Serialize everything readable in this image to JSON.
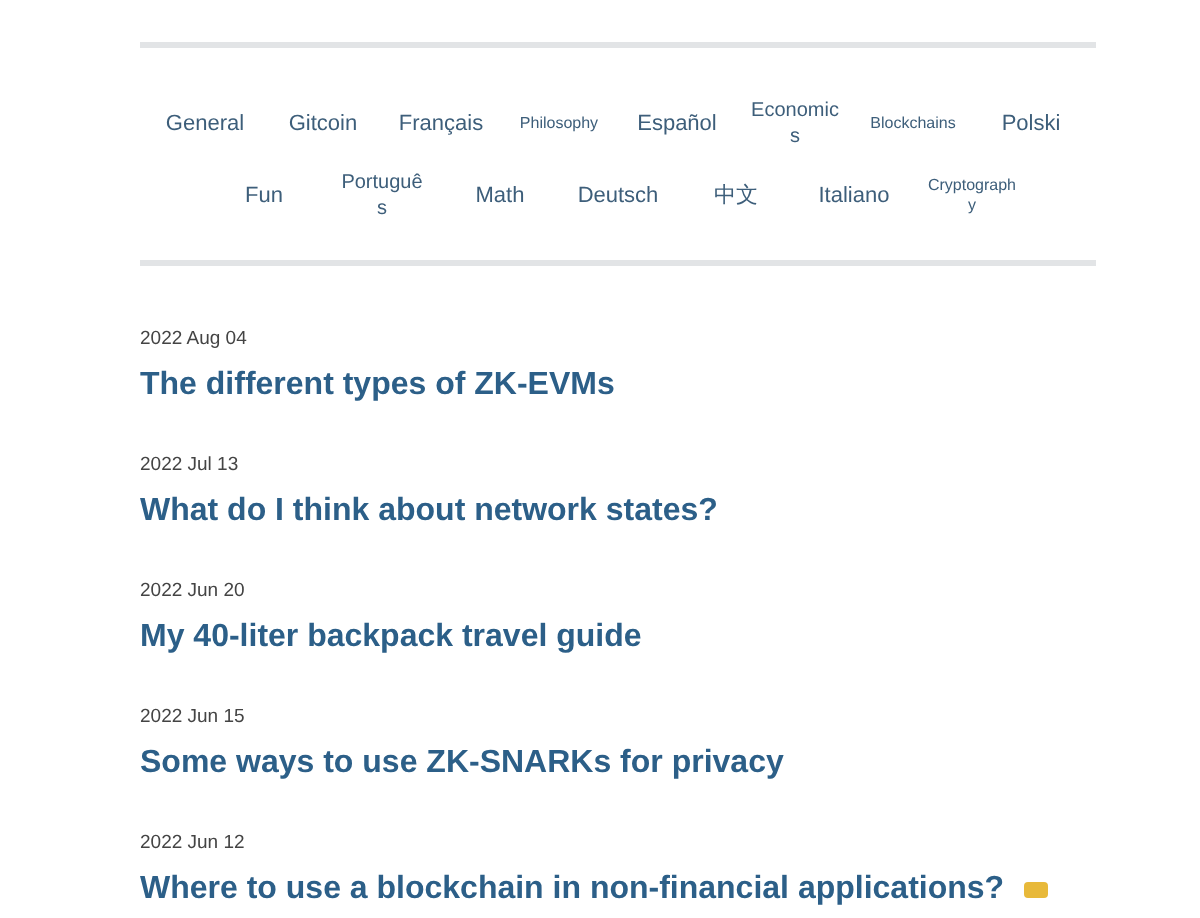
{
  "categories": [
    {
      "label": "General",
      "kind": "large"
    },
    {
      "label": "Gitcoin",
      "kind": "large"
    },
    {
      "label": "Français",
      "kind": "large"
    },
    {
      "label": "Philosophy",
      "kind": "small"
    },
    {
      "label": "Español",
      "kind": "large"
    },
    {
      "label": "Economics",
      "kind": "medium"
    },
    {
      "label": "Blockchains",
      "kind": "small"
    },
    {
      "label": "Polski",
      "kind": "large"
    },
    {
      "label": "Fun",
      "kind": "large"
    },
    {
      "label": "Português",
      "kind": "medium"
    },
    {
      "label": "Math",
      "kind": "large"
    },
    {
      "label": "Deutsch",
      "kind": "large"
    },
    {
      "label": "中文",
      "kind": "large"
    },
    {
      "label": "Italiano",
      "kind": "large"
    },
    {
      "label": "Cryptography",
      "kind": "small"
    }
  ],
  "posts": [
    {
      "date": "2022 Aug 04",
      "title": "The different types of ZK-EVMs"
    },
    {
      "date": "2022 Jul 13",
      "title": "What do I think about network states?"
    },
    {
      "date": "2022 Jun 20",
      "title": "My 40-liter backpack travel guide"
    },
    {
      "date": "2022 Jun 15",
      "title": "Some ways to use ZK-SNARKs for privacy"
    },
    {
      "date": "2022 Jun 12",
      "title": "Where to use a blockchain in non-financial applications?",
      "flagged": true
    }
  ]
}
